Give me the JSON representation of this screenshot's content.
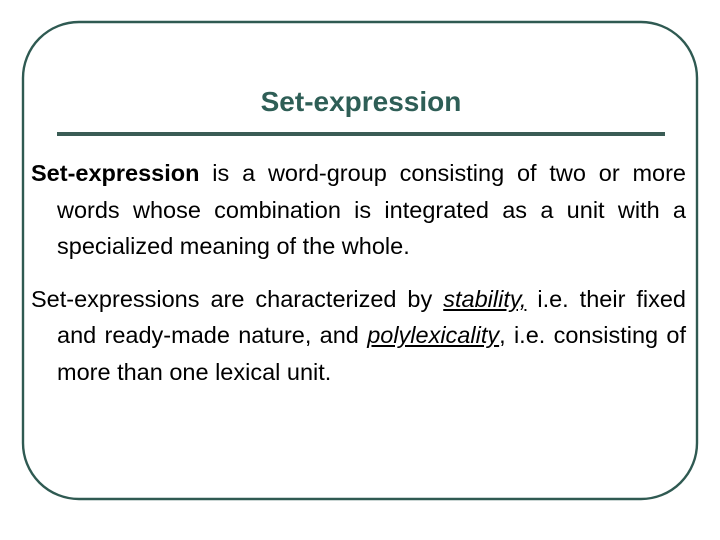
{
  "slide": {
    "title": "Set-expression",
    "frame_color": "#2f5a52",
    "title_color": "#2e5e56",
    "rule_color": "#3a5c55",
    "body_color": "#000000",
    "background_color": "#ffffff"
  },
  "paragraph1": {
    "lead_bold": "Set-expression",
    "rest": " is a word-group consisting of two or more words whose combination is integrated as a unit with a specialized meaning of the whole."
  },
  "paragraph2": {
    "part1": "Set-expressions are characterized by ",
    "emphasis1": "stability,",
    "part2": " i.e. their fixed and ready-made nature, and ",
    "emphasis2": "polylexicality",
    "part3": ", i.e. consisting of more than one lexical unit."
  }
}
